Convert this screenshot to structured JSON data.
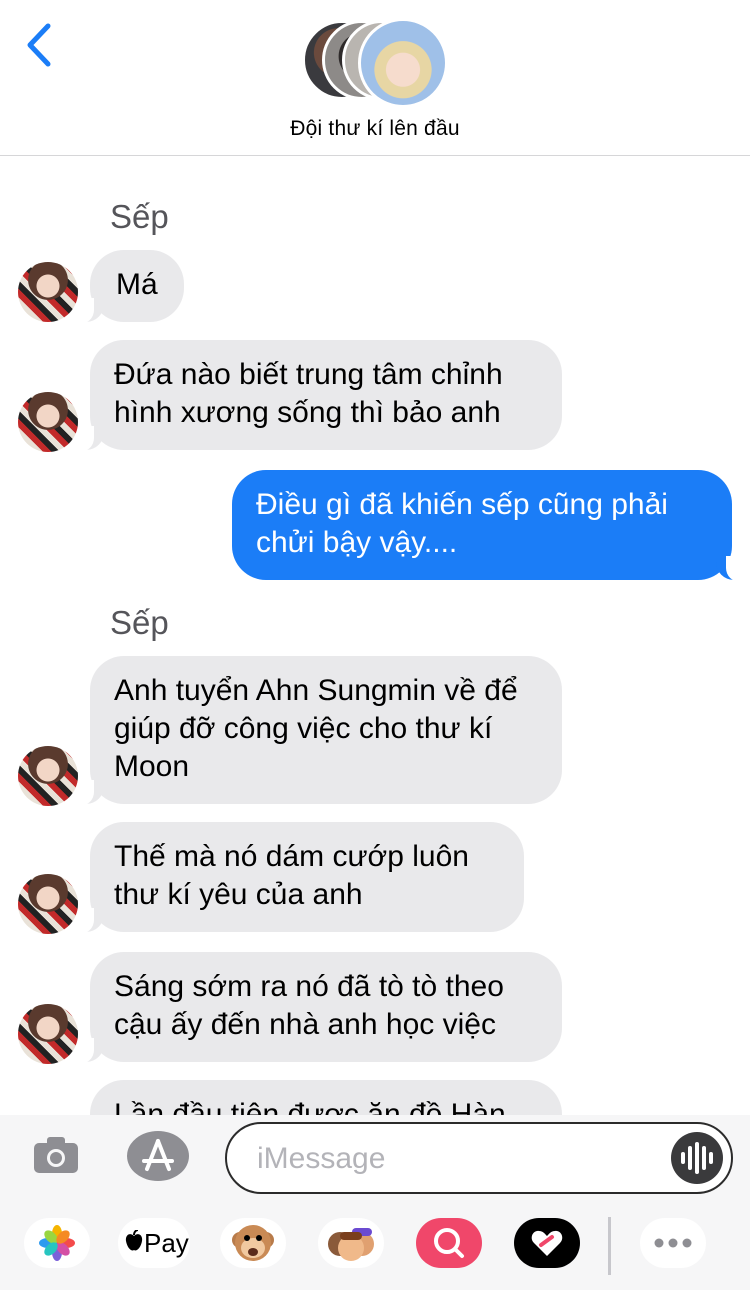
{
  "header": {
    "group_name": "Đội thư kí lên đầu",
    "back_icon": "chevron-left-icon",
    "accent_color": "#1b7df7"
  },
  "thread": {
    "sender_1": "Sếp",
    "msg_1": "Má",
    "msg_2": "Đứa nào biết trung tâm chỉnh hình xương sống thì bảo anh",
    "msg_3": "Điều gì đã khiến sếp cũng phải chửi bậy vậy....",
    "sender_2": "Sếp",
    "msg_4": "Anh tuyển Ahn Sungmin về để giúp đỡ công việc cho thư kí Moon",
    "msg_5": "Thế mà nó dám cướp luôn thư kí yêu của anh",
    "msg_6": "Sáng sớm ra nó đã tò tò theo cậu ấy đến nhà anh học việc",
    "msg_7": "Lần đầu tiên được ăn đồ Hàn"
  },
  "input": {
    "placeholder": "iMessage",
    "camera_icon": "camera-icon",
    "appstore_icon": "app-store-icon",
    "voice_icon": "waveform-icon"
  },
  "drawer": {
    "apple_pay_label": "Pay",
    "apps": [
      "photos-icon",
      "apple-pay-icon",
      "animoji-icon",
      "memoji-icon",
      "image-search-icon",
      "digital-touch-icon",
      "more-icon"
    ]
  }
}
